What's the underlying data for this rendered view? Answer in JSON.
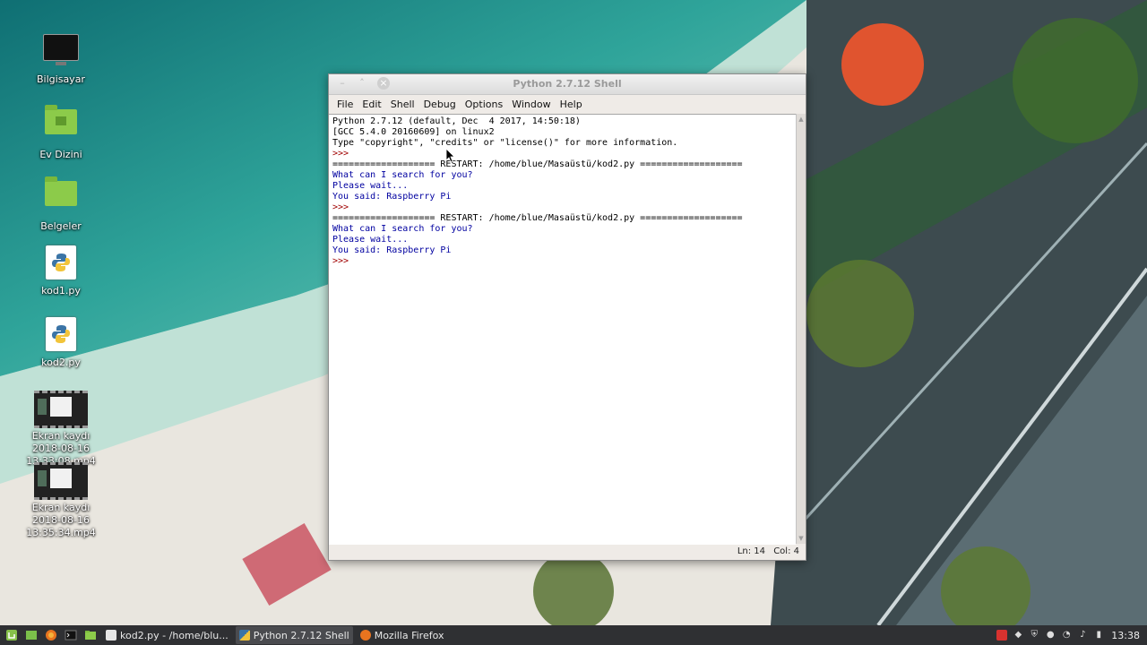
{
  "desktop": {
    "icons": [
      {
        "label": "Bilgisayar"
      },
      {
        "label": "Ev Dizini"
      },
      {
        "label": "Belgeler"
      },
      {
        "label": "kod1.py"
      },
      {
        "label": "kod2.py"
      },
      {
        "label": "Ekran kaydı 2018-08-16 13:33:08.mp4"
      },
      {
        "label": "Ekran kaydı 2018-08-16 13:35:34.mp4"
      }
    ]
  },
  "window": {
    "title": "Python 2.7.12 Shell",
    "menu": [
      "File",
      "Edit",
      "Shell",
      "Debug",
      "Options",
      "Window",
      "Help"
    ],
    "shell_lines": [
      {
        "text": "Python 2.7.12 (default, Dec  4 2017, 14:50:18)",
        "style": "black"
      },
      {
        "text": "[GCC 5.4.0 20160609] on linux2",
        "style": "black"
      },
      {
        "text": "Type \"copyright\", \"credits\" or \"license()\" for more information.",
        "style": "black"
      },
      {
        "text": ">>> ",
        "style": "prompt"
      },
      {
        "text": "=================== RESTART: /home/blue/Masaüstü/kod2.py ===================",
        "style": "restart"
      },
      {
        "text": "What can I search for you?",
        "style": "out"
      },
      {
        "text": "Please wait...",
        "style": "out"
      },
      {
        "text": "You said: Raspberry Pi",
        "style": "out"
      },
      {
        "text": ">>> ",
        "style": "prompt"
      },
      {
        "text": "=================== RESTART: /home/blue/Masaüstü/kod2.py ===================",
        "style": "restart"
      },
      {
        "text": "What can I search for you?",
        "style": "out"
      },
      {
        "text": "Please wait...",
        "style": "out"
      },
      {
        "text": "You said: Raspberry Pi",
        "style": "out"
      },
      {
        "text": ">>> ",
        "style": "prompt"
      }
    ],
    "status": {
      "line": "Ln: 14",
      "col": "Col: 4"
    }
  },
  "taskbar": {
    "tasks": [
      {
        "label": "kod2.py - /home/blu...",
        "active": false
      },
      {
        "label": "Python 2.7.12 Shell",
        "active": true
      },
      {
        "label": "Mozilla Firefox",
        "active": false
      }
    ],
    "clock": "13:38"
  },
  "colors": {
    "prompt": "#a00000",
    "output": "#0000a0",
    "taskbar": "#2f3033",
    "folder": "#8ccb4a"
  }
}
